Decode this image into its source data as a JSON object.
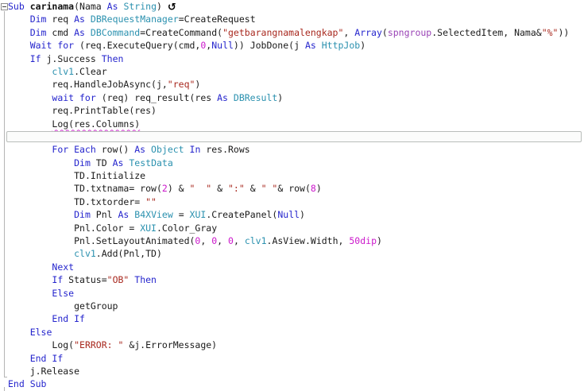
{
  "editor": {
    "app": "B4X IDE code editor",
    "resumable_icon": "↺",
    "fold_marker": "-",
    "colors": {
      "keyword": "#2525cd",
      "type": "#2b91af",
      "string": "#a8281e",
      "number": "#cb17cb",
      "view": "#9a43b6",
      "global": "#2b91af",
      "default": "#1a1a1a",
      "subname": "#111111",
      "icon": "#000000",
      "wave": "#d233d2",
      "boxborder": "#b9bdba",
      "foldbox": "#8c8c8c",
      "foldline": "#b5b5b5"
    },
    "lines": [
      {
        "ind": 0,
        "icon": true,
        "tokens": [
          [
            "k",
            "Sub"
          ],
          [
            "d",
            " "
          ],
          [
            "b",
            "carinama"
          ],
          [
            "d",
            "(Nama "
          ],
          [
            "k",
            "As"
          ],
          [
            "d",
            " "
          ],
          [
            "t",
            "String"
          ],
          [
            "d",
            ") "
          ]
        ]
      },
      {
        "ind": 1,
        "tokens": [
          [
            "k",
            "Dim"
          ],
          [
            "d",
            " req "
          ],
          [
            "k",
            "As"
          ],
          [
            "d",
            " "
          ],
          [
            "t",
            "DBRequestManager"
          ],
          [
            "d",
            "=CreateRequest"
          ]
        ]
      },
      {
        "ind": 1,
        "tokens": [
          [
            "k",
            "Dim"
          ],
          [
            "d",
            " cmd "
          ],
          [
            "k",
            "As"
          ],
          [
            "d",
            " "
          ],
          [
            "t",
            "DBCommand"
          ],
          [
            "d",
            "=CreateCommand("
          ],
          [
            "s",
            "\"getbarangnamalengkap\""
          ],
          [
            "d",
            ", "
          ],
          [
            "k",
            "Array"
          ],
          [
            "d",
            "("
          ],
          [
            "v",
            "spngroup"
          ],
          [
            "d",
            ".SelectedItem, Nama&"
          ],
          [
            "s",
            "\"%\""
          ],
          [
            "d",
            "))"
          ]
        ]
      },
      {
        "ind": 1,
        "tokens": [
          [
            "k",
            "Wait for"
          ],
          [
            "d",
            " (req.ExecuteQuery(cmd,"
          ],
          [
            "n",
            "0"
          ],
          [
            "d",
            ","
          ],
          [
            "k",
            "Null"
          ],
          [
            "d",
            ")) JobDone(j "
          ],
          [
            "k",
            "As"
          ],
          [
            "d",
            " "
          ],
          [
            "t",
            "HttpJob"
          ],
          [
            "d",
            ")"
          ]
        ]
      },
      {
        "ind": 1,
        "tokens": [
          [
            "k",
            "If"
          ],
          [
            "d",
            " j.Success "
          ],
          [
            "k",
            "Then"
          ]
        ]
      },
      {
        "ind": 2,
        "tokens": [
          [
            "g",
            "clv1"
          ],
          [
            "d",
            ".Clear"
          ]
        ]
      },
      {
        "ind": 2,
        "tokens": [
          [
            "d",
            "req.HandleJobAsync(j,"
          ],
          [
            "s",
            "\"req\""
          ],
          [
            "d",
            ")"
          ]
        ]
      },
      {
        "ind": 2,
        "tokens": [
          [
            "k",
            "wait for"
          ],
          [
            "d",
            " (req) req_result(res "
          ],
          [
            "k",
            "As"
          ],
          [
            "d",
            " "
          ],
          [
            "t",
            "DBResult"
          ],
          [
            "d",
            ")"
          ]
        ]
      },
      {
        "ind": 2,
        "tokens": [
          [
            "d",
            "req.PrintTable(res)"
          ]
        ]
      },
      {
        "ind": 2,
        "wavy": true,
        "tokens": [
          [
            "d",
            "Log(res.Columns)"
          ]
        ]
      },
      {
        "ind": 0,
        "box": true,
        "tokens": []
      },
      {
        "ind": 2,
        "tokens": [
          [
            "k",
            "For Each"
          ],
          [
            "d",
            " row() "
          ],
          [
            "k",
            "As"
          ],
          [
            "d",
            " "
          ],
          [
            "t",
            "Object"
          ],
          [
            "d",
            " "
          ],
          [
            "k",
            "In"
          ],
          [
            "d",
            " res.Rows"
          ]
        ]
      },
      {
        "ind": 3,
        "tokens": [
          [
            "k",
            "Dim"
          ],
          [
            "d",
            " TD "
          ],
          [
            "k",
            "As"
          ],
          [
            "d",
            " "
          ],
          [
            "t",
            "TestData"
          ]
        ]
      },
      {
        "ind": 3,
        "tokens": [
          [
            "d",
            "TD.Initialize"
          ]
        ]
      },
      {
        "ind": 3,
        "tokens": [
          [
            "d",
            "TD.txtnama= row("
          ],
          [
            "n",
            "2"
          ],
          [
            "d",
            ") & "
          ],
          [
            "s",
            "\"  \""
          ],
          [
            "d",
            " & "
          ],
          [
            "s",
            "\":\""
          ],
          [
            "d",
            " & "
          ],
          [
            "s",
            "\" \""
          ],
          [
            "d",
            "& row("
          ],
          [
            "n",
            "8"
          ],
          [
            "d",
            ")"
          ]
        ]
      },
      {
        "ind": 3,
        "tokens": [
          [
            "d",
            "TD.txtorder= "
          ],
          [
            "s",
            "\"\""
          ]
        ]
      },
      {
        "ind": 3,
        "tokens": [
          [
            "k",
            "Dim"
          ],
          [
            "d",
            " Pnl "
          ],
          [
            "k",
            "As"
          ],
          [
            "d",
            " "
          ],
          [
            "t",
            "B4XView"
          ],
          [
            "d",
            " = "
          ],
          [
            "t",
            "XUI"
          ],
          [
            "d",
            ".CreatePanel("
          ],
          [
            "k",
            "Null"
          ],
          [
            "d",
            ")"
          ]
        ]
      },
      {
        "ind": 3,
        "tokens": [
          [
            "d",
            "Pnl.Color = "
          ],
          [
            "t",
            "XUI"
          ],
          [
            "d",
            ".Color_Gray"
          ]
        ]
      },
      {
        "ind": 3,
        "tokens": [
          [
            "d",
            "Pnl.SetLayoutAnimated("
          ],
          [
            "n",
            "0"
          ],
          [
            "d",
            ", "
          ],
          [
            "n",
            "0"
          ],
          [
            "d",
            ", "
          ],
          [
            "n",
            "0"
          ],
          [
            "d",
            ", "
          ],
          [
            "g",
            "clv1"
          ],
          [
            "d",
            ".AsView.Width, "
          ],
          [
            "n",
            "50dip"
          ],
          [
            "d",
            ")"
          ]
        ]
      },
      {
        "ind": 3,
        "tokens": [
          [
            "g",
            "clv1"
          ],
          [
            "d",
            ".Add(Pnl,TD)"
          ]
        ]
      },
      {
        "ind": 2,
        "tokens": [
          [
            "k",
            "Next"
          ]
        ]
      },
      {
        "ind": 2,
        "tokens": [
          [
            "k",
            "If"
          ],
          [
            "d",
            " Status="
          ],
          [
            "s",
            "\"OB\""
          ],
          [
            "d",
            " "
          ],
          [
            "k",
            "Then"
          ]
        ]
      },
      {
        "ind": 2,
        "tokens": [
          [
            "k",
            "Else"
          ]
        ]
      },
      {
        "ind": 3,
        "tokens": [
          [
            "d",
            "getGroup"
          ]
        ]
      },
      {
        "ind": 2,
        "tokens": [
          [
            "k",
            "End If"
          ]
        ]
      },
      {
        "ind": 1,
        "tokens": [
          [
            "k",
            "Else"
          ]
        ]
      },
      {
        "ind": 2,
        "tokens": [
          [
            "d",
            "Log("
          ],
          [
            "s",
            "\"ERROR: \""
          ],
          [
            "d",
            " &j.ErrorMessage)"
          ]
        ]
      },
      {
        "ind": 1,
        "tokens": [
          [
            "k",
            "End If"
          ]
        ]
      },
      {
        "ind": 1,
        "tokens": [
          [
            "d",
            "j.Release"
          ]
        ]
      },
      {
        "ind": 0,
        "tokens": [
          [
            "k",
            "End Sub"
          ]
        ]
      }
    ]
  }
}
